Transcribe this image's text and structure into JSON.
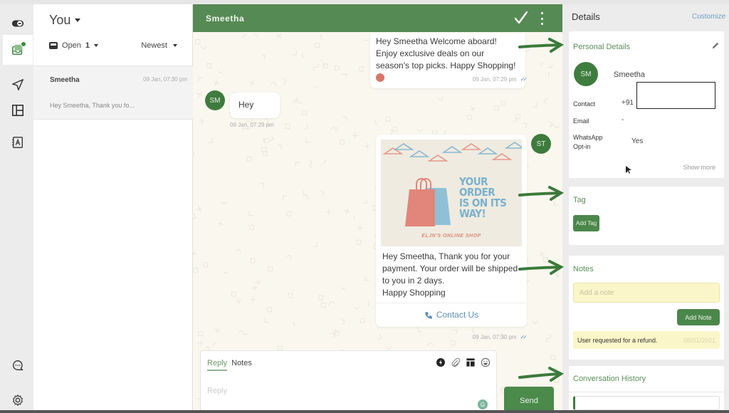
{
  "rail": {
    "items": [
      {
        "name": "toggle-icon",
        "label": "toggle"
      },
      {
        "name": "inbox-icon",
        "label": "inbox",
        "badge": true
      },
      {
        "name": "send-icon",
        "label": "campaigns"
      },
      {
        "name": "layout-icon",
        "label": "templates"
      },
      {
        "name": "contacts-icon",
        "label": "contacts"
      },
      {
        "name": "chat-icon",
        "label": "chat"
      },
      {
        "name": "gear-icon",
        "label": "settings"
      }
    ]
  },
  "conversations": {
    "owner": "You",
    "filter": {
      "status": "Open",
      "count": "1",
      "sort": "Newest"
    },
    "items": [
      {
        "name": "Smeetha",
        "time": "09 Jan, 07:30 pm",
        "preview": "Hey Smeetha, Thank you fo..."
      }
    ]
  },
  "chat": {
    "contact": "Smeetha",
    "messages": [
      {
        "direction": "out",
        "text": "Hey Smeetha Welcome aboard! Enjoy exclusive deals on our season's top picks. Happy Shopping!",
        "time": "09 Jan, 07:29 pm",
        "status": "read"
      },
      {
        "direction": "in",
        "avatar": "SM",
        "text": "Hey",
        "time": "09 Jan, 07:29 pm"
      },
      {
        "direction": "out",
        "avatar": "ST",
        "banner": {
          "line1": "YOUR ORDER",
          "line2": "IS ON ITS",
          "line3": "WAY!",
          "shop": "ELJN'S ONLINE SHOP"
        },
        "line1": "Hey Smeetha, Thank you for your",
        "line2": "payment. Your order will be shipped",
        "line3": "to you in 2 days.",
        "line4": "Happy Shopping",
        "button": "Contact Us",
        "time": "09 Jan, 07:30 pm",
        "status": "read"
      }
    ],
    "composer": {
      "tabs": [
        "Reply",
        "Notes"
      ],
      "active_tab": "Reply",
      "placeholder": "Reply",
      "value": "",
      "send_label": "Send"
    }
  },
  "details": {
    "title": "Details",
    "customize": "Customize",
    "personal": {
      "title": "Personal Details",
      "initials": "SM",
      "name": "Smeetha",
      "contact_label": "Contact",
      "contact_value": "+91",
      "email_label": "Email",
      "email_value": "-",
      "optin_label_1": "WhatsApp",
      "optin_label_2": "Opt-in",
      "optin_value": "Yes",
      "show_more": "Show more"
    },
    "tag": {
      "title": "Tag",
      "add_label": "Add Tag"
    },
    "notes": {
      "title": "Notes",
      "placeholder": "Add a note",
      "add_label": "Add Note",
      "items": [
        {
          "text": "User requested for a refund.",
          "date": "08/01/2021"
        }
      ]
    },
    "history": {
      "title": "Conversation History"
    }
  },
  "colors": {
    "brand_green": "#568a54",
    "button_green": "#4b874b",
    "chat_bg": "#faf7ef",
    "note_yellow": "#fbf6c9",
    "link_blue": "#6aa0c4"
  }
}
